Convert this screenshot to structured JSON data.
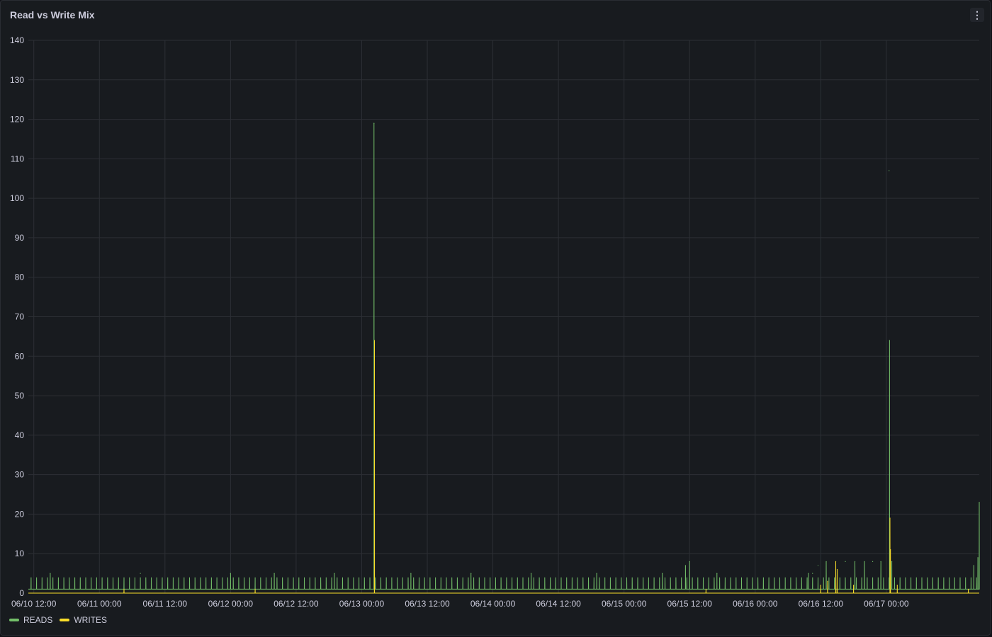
{
  "panel": {
    "title": "Read vs Write Mix",
    "menu_icon": "kebab-vertical-icon"
  },
  "colors": {
    "reads": "#73bf69",
    "writes": "#fade2a",
    "grid": "#2c2f35",
    "background": "#181b1f"
  },
  "chart_data": {
    "type": "line",
    "title": "Read vs Write Mix",
    "xlabel": "",
    "ylabel": "",
    "ylim": [
      0,
      140
    ],
    "y_ticks": [
      0,
      10,
      20,
      30,
      40,
      50,
      60,
      70,
      80,
      90,
      100,
      110,
      120,
      130,
      140
    ],
    "x_range": [
      "2025-06-10 11:00",
      "2025-06-17 17:00"
    ],
    "x_ticks": [
      "06/10 12:00",
      "06/11 00:00",
      "06/11 12:00",
      "06/12 00:00",
      "06/12 12:00",
      "06/13 00:00",
      "06/13 12:00",
      "06/14 00:00",
      "06/14 12:00",
      "06/15 00:00",
      "06/15 12:00",
      "06/16 00:00",
      "06/16 12:00",
      "06/17 00:00"
    ],
    "grid": true,
    "legend_position": "bottom-left",
    "series": [
      {
        "name": "READS",
        "color": "#73bf69",
        "baseline": 1,
        "spikes": [
          [
            "2025-06-13 02:15",
            119
          ],
          [
            "2025-06-17 00:30",
            107
          ],
          [
            "2025-06-17 00:35",
            64
          ],
          [
            "2025-06-17 17:00",
            23
          ],
          [
            "2025-06-17 16:45",
            9
          ],
          [
            "2025-06-17 16:00",
            7
          ],
          [
            "2025-06-15 12:00",
            8
          ],
          [
            "2025-06-15 11:15",
            7
          ],
          [
            "2025-06-16 16:30",
            8
          ],
          [
            "2025-06-16 18:15",
            8
          ],
          [
            "2025-06-16 20:00",
            8
          ],
          [
            "2025-06-16 21:30",
            8
          ],
          [
            "2025-06-16 23:00",
            8
          ],
          [
            "2025-06-17 01:00",
            8
          ],
          [
            "2025-06-16 13:00",
            8
          ],
          [
            "2025-06-16 11:30",
            7
          ],
          [
            "2025-06-16 10:30",
            5
          ],
          [
            "2025-06-16 09:45",
            5
          ],
          [
            "2025-06-11 07:30",
            5
          ],
          [
            "2025-06-12 00:00",
            5
          ],
          [
            "2025-06-12 08:00",
            5
          ],
          [
            "2025-06-12 19:00",
            5
          ],
          [
            "2025-06-10 15:00",
            5
          ],
          [
            "2025-06-13 09:00",
            5
          ],
          [
            "2025-06-13 20:00",
            5
          ],
          [
            "2025-06-14 07:00",
            5
          ],
          [
            "2025-06-14 19:00",
            5
          ],
          [
            "2025-06-15 07:00",
            5
          ],
          [
            "2025-06-15 17:00",
            5
          ]
        ]
      },
      {
        "name": "WRITES",
        "color": "#fade2a",
        "baseline": 0,
        "spikes": [
          [
            "2025-06-13 02:20",
            64
          ],
          [
            "2025-06-17 00:40",
            19
          ],
          [
            "2025-06-17 00:45",
            11
          ],
          [
            "2025-06-16 14:45",
            8
          ],
          [
            "2025-06-16 15:00",
            6
          ],
          [
            "2025-06-16 13:15",
            3
          ],
          [
            "2025-06-16 12:00",
            2
          ],
          [
            "2025-06-17 02:00",
            2
          ],
          [
            "2025-06-16 18:00",
            2
          ],
          [
            "2025-06-11 04:30",
            1
          ],
          [
            "2025-06-12 04:30",
            1
          ],
          [
            "2025-06-15 15:00",
            1
          ],
          [
            "2025-06-17 15:00",
            1
          ]
        ]
      }
    ],
    "periodic_reads": {
      "interval_minutes": 60,
      "value": 4
    }
  }
}
